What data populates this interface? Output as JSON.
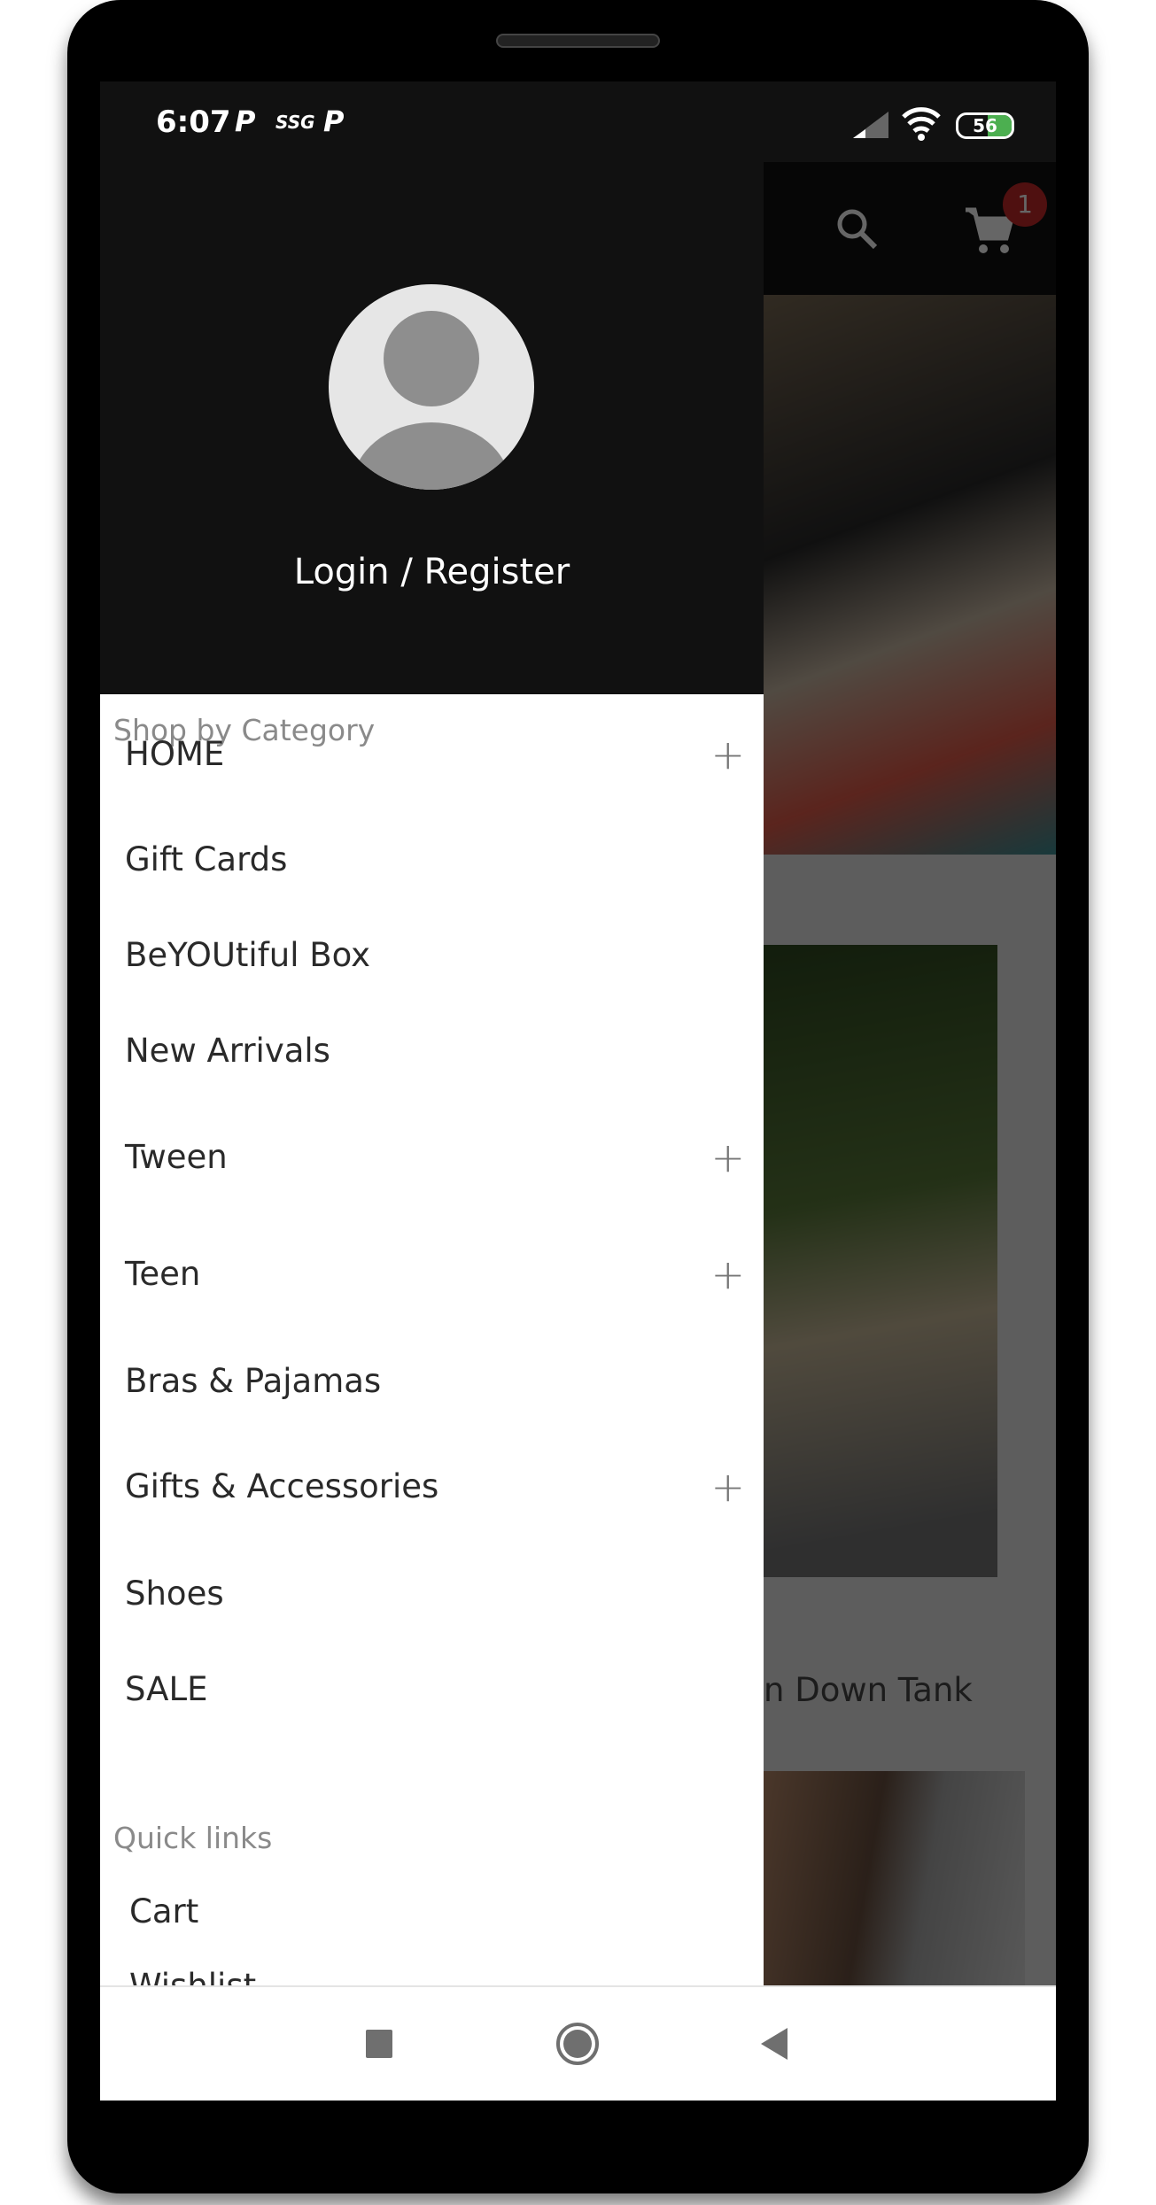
{
  "status_bar": {
    "time": "6:07",
    "notif_icons": [
      "P",
      "SSG",
      "P"
    ],
    "battery": "56"
  },
  "app_bar": {
    "cart_badge": "1",
    "icons": [
      "search-icon",
      "cart-icon"
    ]
  },
  "background": {
    "product_title_partial": "n Down Tank"
  },
  "drawer": {
    "login_label": "Login / Register",
    "shop_section": "Shop by Category",
    "categories": [
      {
        "label": "HOME",
        "expandable": true
      },
      {
        "label": "Gift Cards",
        "expandable": false
      },
      {
        "label": "BeYOUtiful Box",
        "expandable": false
      },
      {
        "label": "New Arrivals",
        "expandable": false
      },
      {
        "label": "Tween",
        "expandable": true
      },
      {
        "label": "Teen",
        "expandable": true
      },
      {
        "label": "Bras & Pajamas",
        "expandable": false
      },
      {
        "label": "Gifts & Accessories",
        "expandable": true
      },
      {
        "label": "Shoes",
        "expandable": false
      },
      {
        "label": "SALE",
        "expandable": false
      }
    ],
    "quick_section": "Quick links",
    "quick_links": [
      "Cart",
      "Wishlist"
    ],
    "plus_glyph": "+"
  },
  "colors": {
    "badge": "#c62828",
    "battery": "#4caf50",
    "header": "#111111"
  }
}
